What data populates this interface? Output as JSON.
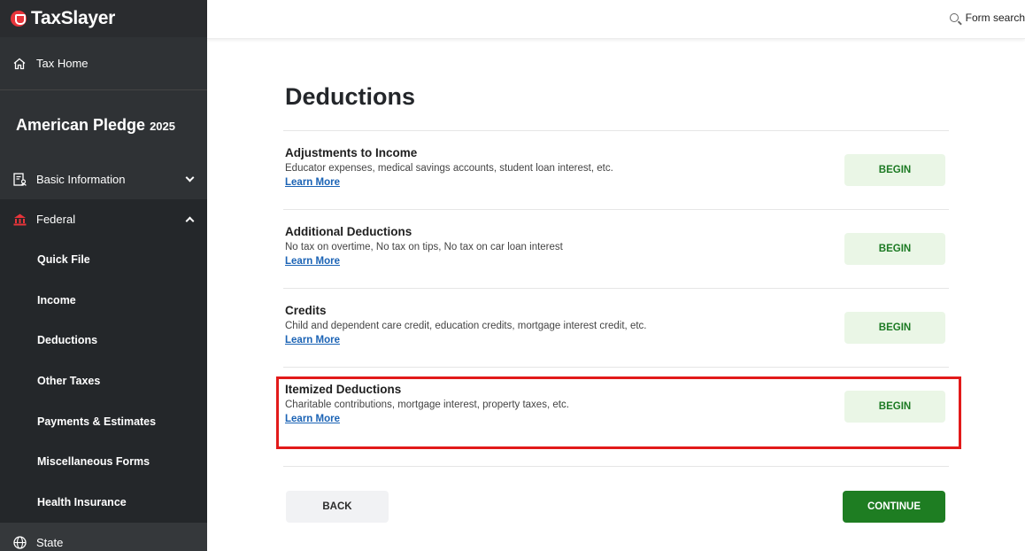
{
  "brand": {
    "name": "TaxSlayer"
  },
  "topbar": {
    "search_label": "Form search",
    "search_icon": "search-icon"
  },
  "sidebar": {
    "tax_home": {
      "label": "Tax Home",
      "icon": "home-icon"
    },
    "return_name": "American Pledge",
    "return_year": "2025",
    "basic_info": {
      "label": "Basic Information",
      "icon": "document-user-icon"
    },
    "federal": {
      "label": "Federal",
      "icon": "capitol-building-icon"
    },
    "federal_items": [
      {
        "label": "Quick File"
      },
      {
        "label": "Income"
      },
      {
        "label": "Deductions"
      },
      {
        "label": "Other Taxes"
      },
      {
        "label": "Payments & Estimates"
      },
      {
        "label": "Miscellaneous Forms"
      },
      {
        "label": "Health Insurance"
      }
    ],
    "state": {
      "label": "State",
      "icon": "globe-icon"
    }
  },
  "main": {
    "title": "Deductions",
    "sections": [
      {
        "title": "Adjustments to Income",
        "description": "Educator expenses, medical savings accounts, student loan interest, etc.",
        "link": "Learn More",
        "button": "BEGIN"
      },
      {
        "title": "Additional Deductions",
        "description": "No tax on overtime, No tax on tips, No tax on car loan interest",
        "link": "Learn More",
        "button": "BEGIN"
      },
      {
        "title": "Credits",
        "description": "Child and dependent care credit, education credits, mortgage interest credit, etc.",
        "link": "Learn More",
        "button": "BEGIN"
      },
      {
        "title": "Itemized Deductions",
        "description": "Charitable contributions, mortgage interest, property taxes, etc.",
        "link": "Learn More",
        "button": "BEGIN"
      }
    ],
    "back_label": "BACK",
    "continue_label": "CONTINUE"
  },
  "colors": {
    "sidebar_bg": "#2f3235",
    "accent_green": "#1e7d22",
    "begin_bg": "#eaf6e6",
    "link_blue": "#1b63b5",
    "highlight_red": "#e21a1a",
    "brand_red": "#e8343a"
  }
}
